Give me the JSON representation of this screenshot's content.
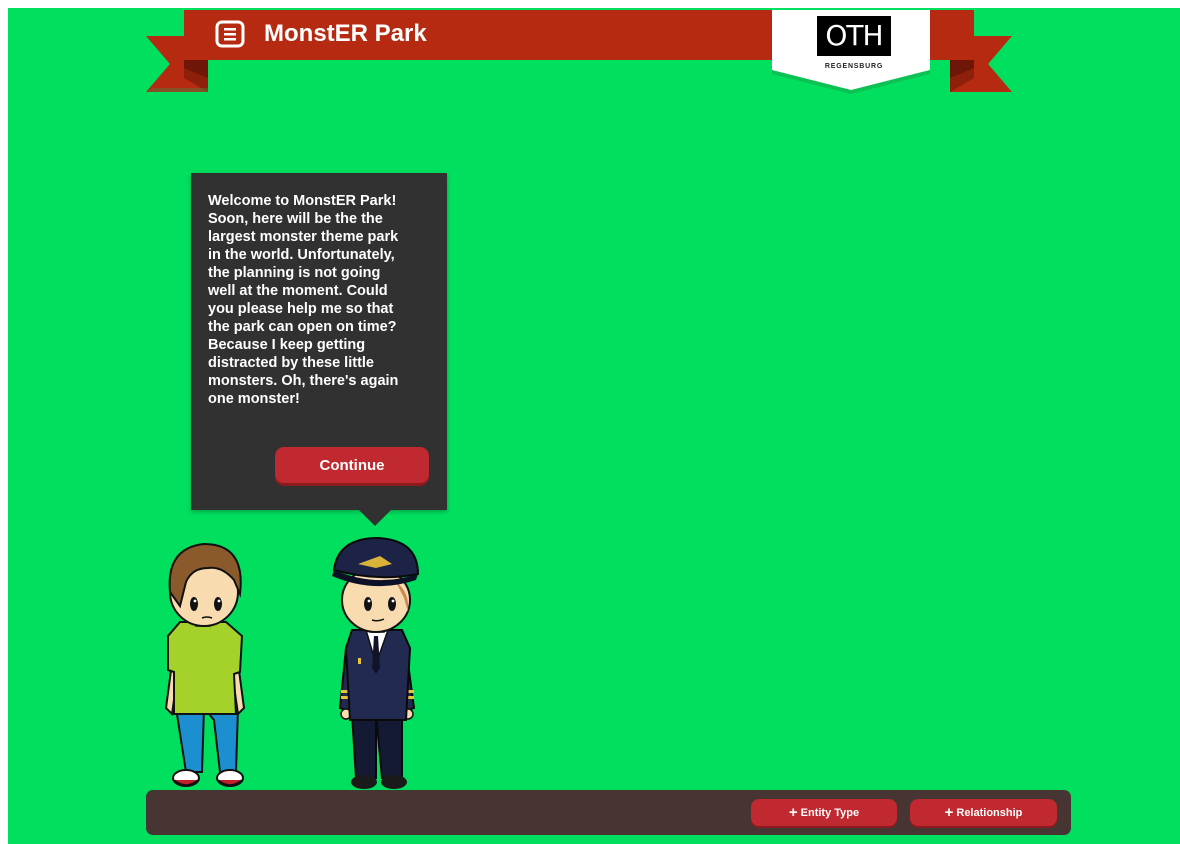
{
  "app": {
    "title": "MonstER Park",
    "menu_icon": "menu-list-icon",
    "logo_text": "OTH",
    "logo_subtext": "REGENSBURG"
  },
  "dialog": {
    "text": "Welcome to MonstER Park!\nSoon, here will be the the\nlargest monster theme park\nin the world. Unfortunately,\nthe planning is not going\nwell at the moment. Could\nyou please help me so that\nthe park can open on time?\nBecause I keep getting\ndistracted by these little\nmonsters. Oh, there's again\none monster!",
    "continue_label": "Continue"
  },
  "toolbar": {
    "entity_type_label": "Entity Type",
    "relationship_label": "Relationship",
    "add_icon": "plus-icon"
  },
  "colors": {
    "background": "#00df5e",
    "banner": "#b52a10",
    "banner_dark": "#6e1607",
    "dialog": "#313131",
    "button": "#c0292f",
    "bottom_bar": "#463532"
  }
}
